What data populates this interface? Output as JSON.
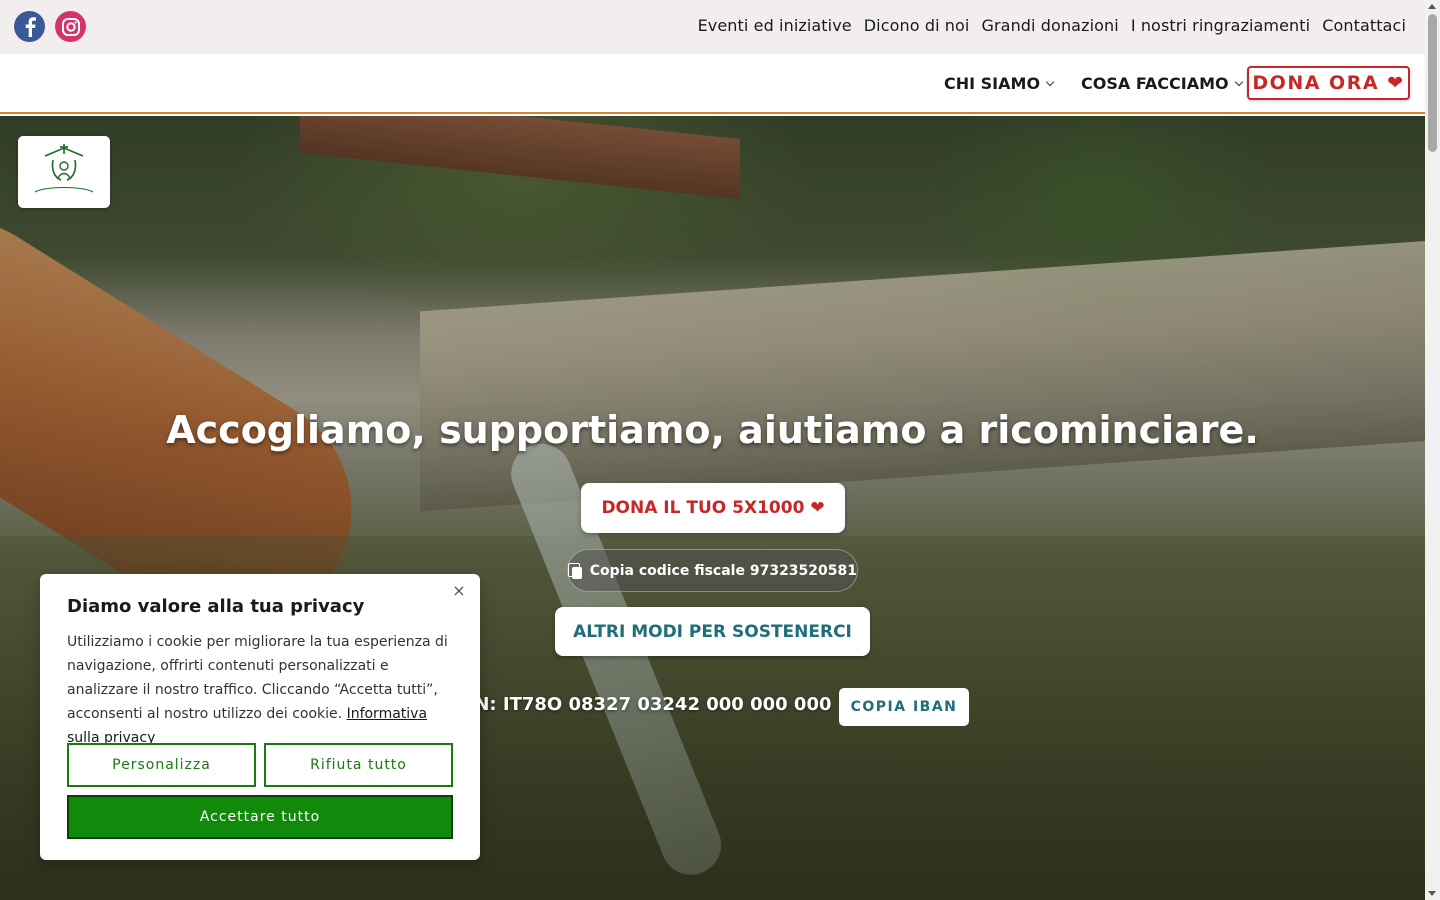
{
  "social": {
    "facebook_icon": "facebook-icon",
    "instagram_icon": "instagram-icon"
  },
  "top_links": [
    {
      "label": "Eventi ed iniziative"
    },
    {
      "label": "Dicono di noi"
    },
    {
      "label": "Grandi donazioni"
    },
    {
      "label": "I nostri ringraziamenti"
    },
    {
      "label": "Contattaci"
    }
  ],
  "nav": {
    "chi_siamo": "CHI SIAMO",
    "cosa_facciamo": "COSA FACCIAMO",
    "dona_ora": "DONA ORA ❤"
  },
  "hero": {
    "headline": "Accogliamo, supportiamo, aiutiamo a ricominciare.",
    "dona_5x1000": "DONA IL TUO 5X1000 ❤",
    "copia_codice": "Copia codice fiscale 97323520581",
    "altri_modi": "ALTRI MODI PER SOSTENERCI",
    "iban_text": "IBAN: IT78O 08327 03242 000 000 000 588",
    "copia_iban": "COPIA IBAN"
  },
  "cookie": {
    "title": "Diamo valore alla tua privacy",
    "text": "Utilizziamo i cookie per migliorare la tua esperienza di navigazione, offrirti contenuti personalizzati e analizzare il nostro traffico. Cliccando “Accetta tutti”, acconsenti al nostro utilizzo dei cookie.",
    "privacy_link": "Informativa sulla privacy",
    "close": "×",
    "personalizza": "Personalizza",
    "rifiuta": "Rifiuta tutto",
    "accetta": "Accettare tutto"
  },
  "colors": {
    "accent_red": "#c62828",
    "teal": "#1f6e7a",
    "green": "#118a0c",
    "nav_border": "#d9822b"
  }
}
